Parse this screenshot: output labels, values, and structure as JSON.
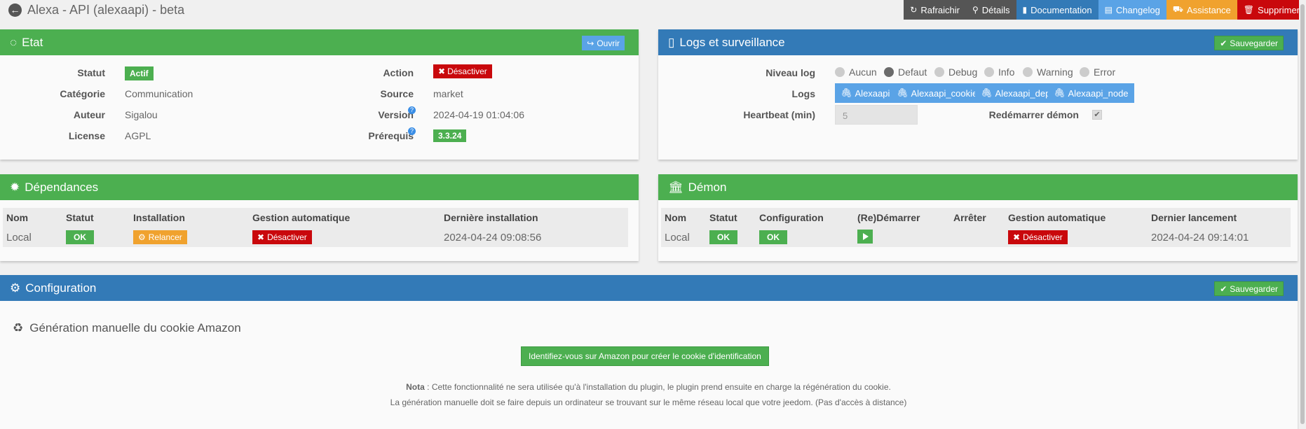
{
  "header": {
    "title": "Alexa - API (alexaapi) - beta",
    "buttons": [
      {
        "label": "Rafraichir",
        "icon": "↻",
        "color": "#555555"
      },
      {
        "label": "Détails",
        "icon": "🔍",
        "color": "#555555"
      },
      {
        "label": "Documentation",
        "icon": "📘",
        "color": "#337ab7"
      },
      {
        "label": "Changelog",
        "icon": "📄",
        "color": "#5aa3e6"
      },
      {
        "label": "Assistance",
        "icon": "🚚",
        "color": "#f0a22e"
      },
      {
        "label": "Supprimer",
        "icon": "🗑",
        "color": "#c9080c"
      }
    ]
  },
  "etat": {
    "title": "Etat",
    "open_label": "Ouvrir",
    "statut_label": "Statut",
    "statut_value": "Actif",
    "categorie_label": "Catégorie",
    "categorie_value": "Communication",
    "auteur_label": "Auteur",
    "auteur_value": "Sigalou",
    "license_label": "License",
    "license_value": "AGPL",
    "action_label": "Action",
    "action_value": "Désactiver",
    "source_label": "Source",
    "source_value": "market",
    "version_label": "Version",
    "version_value": "2024-04-19 01:04:06",
    "prerequis_label": "Prérequis",
    "prerequis_value": "3.3.24"
  },
  "logs": {
    "title": "Logs et surveillance",
    "save_label": "Sauvegarder",
    "niveau_label": "Niveau log",
    "levels": [
      "Aucun",
      "Defaut",
      "Debug",
      "Info",
      "Warning",
      "Error"
    ],
    "selected_level": "Defaut",
    "logs_label": "Logs",
    "log_buttons": [
      "Alexaapi",
      "Alexaapi_cookie",
      "Alexaapi_dep",
      "Alexaapi_node"
    ],
    "heartbeat_label": "Heartbeat (min)",
    "heartbeat_value": "5",
    "restart_label": "Redémarrer démon"
  },
  "dependances": {
    "title": "Dépendances",
    "headers": [
      "Nom",
      "Statut",
      "Installation",
      "Gestion automatique",
      "Dernière installation"
    ],
    "row": {
      "nom": "Local",
      "statut": "OK",
      "installation": "Relancer",
      "gestion": "Désactiver",
      "derniere": "2024-04-24 09:08:56"
    }
  },
  "demon": {
    "title": "Démon",
    "headers": [
      "Nom",
      "Statut",
      "Configuration",
      "(Re)Démarrer",
      "Arrêter",
      "Gestion automatique",
      "Dernier lancement"
    ],
    "row": {
      "nom": "Local",
      "statut": "OK",
      "configuration": "OK",
      "gestion": "Désactiver",
      "dernier": "2024-04-24 09:14:01"
    }
  },
  "configuration": {
    "title": "Configuration",
    "save_label": "Sauvegarder",
    "section_title": "Génération manuelle du cookie Amazon",
    "amazon_button": "Identifiez-vous sur Amazon pour créer le cookie d'identification",
    "nota_label": "Nota",
    "nota_text": " : Cette fonctionnalité ne sera utilisée qu'à l'installation du plugin, le plugin prend ensuite en charge la régénération du cookie.",
    "nota_line2": "La génération manuelle doit se faire depuis un ordinateur se trouvant sur le même réseau local que votre jeedom. (Pas d'accès à distance)"
  }
}
